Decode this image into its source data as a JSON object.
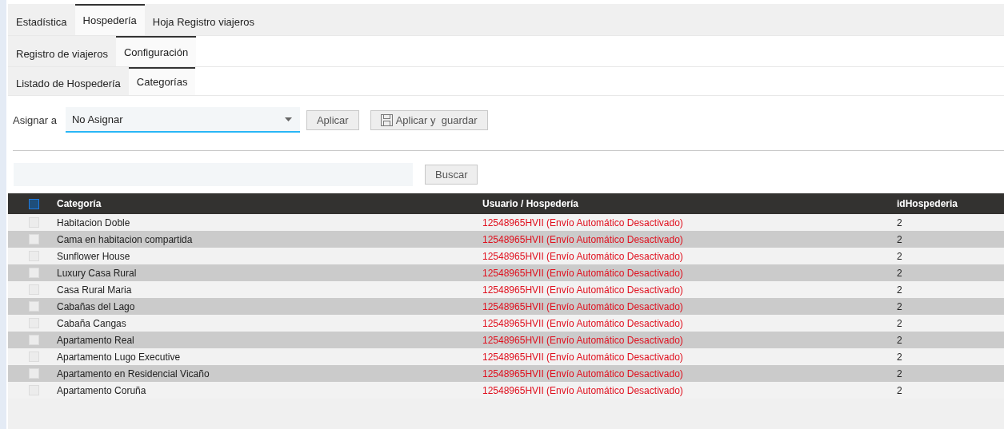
{
  "main_tabs": [
    {
      "label": "Estadística",
      "selected": false
    },
    {
      "label": "Hospedería",
      "selected": true
    },
    {
      "label": "Hoja Registro viajeros",
      "selected": false
    }
  ],
  "sub_tabs": [
    {
      "label": "Registro de viajeros",
      "selected": false
    },
    {
      "label": "Configuración",
      "selected": true
    }
  ],
  "inner_tabs": [
    {
      "label": "Listado de Hospedería",
      "selected": false
    },
    {
      "label": "Categorías",
      "selected": true
    }
  ],
  "assign": {
    "label": "Asignar a",
    "value": "No Asignar",
    "apply": "Aplicar",
    "apply_save": "Aplicar y  guardar"
  },
  "search": {
    "button": "Buscar"
  },
  "table": {
    "header_checked": false,
    "columns": [
      "Categoría",
      "Usuario / Hospedería",
      "idHospederia"
    ],
    "rows": [
      {
        "checked": false,
        "cells": [
          "Habitacion Doble",
          "12548965HVII (Envío Automático Desactivado)",
          "2"
        ]
      },
      {
        "checked": false,
        "cells": [
          "Cama en habitacion compartida",
          "12548965HVII (Envío Automático Desactivado)",
          "2"
        ]
      },
      {
        "checked": false,
        "cells": [
          "Sunflower House",
          "12548965HVII (Envío Automático Desactivado)",
          "2"
        ]
      },
      {
        "checked": false,
        "cells": [
          "Luxury Casa Rural",
          "12548965HVII (Envío Automático Desactivado)",
          "2"
        ]
      },
      {
        "checked": false,
        "cells": [
          "Casa Rural Maria",
          "12548965HVII (Envío Automático Desactivado)",
          "2"
        ]
      },
      {
        "checked": false,
        "cells": [
          "Cabañas del Lago",
          "12548965HVII (Envío Automático Desactivado)",
          "2"
        ]
      },
      {
        "checked": false,
        "cells": [
          "Cabaña Cangas",
          "12548965HVII (Envío Automático Desactivado)",
          "2"
        ]
      },
      {
        "checked": false,
        "cells": [
          "Apartamento Real",
          "12548965HVII (Envío Automático Desactivado)",
          "2"
        ]
      },
      {
        "checked": false,
        "cells": [
          "Apartamento Lugo Executive",
          "12548965HVII (Envío Automático Desactivado)",
          "2"
        ]
      },
      {
        "checked": false,
        "cells": [
          "Apartamento en Residencial Vicaño",
          "12548965HVII (Envío Automático Desactivado)",
          "2"
        ]
      },
      {
        "checked": false,
        "cells": [
          "Apartamento Coruña",
          "12548965HVII (Envío Automático Desactivado)",
          "2"
        ]
      }
    ]
  }
}
